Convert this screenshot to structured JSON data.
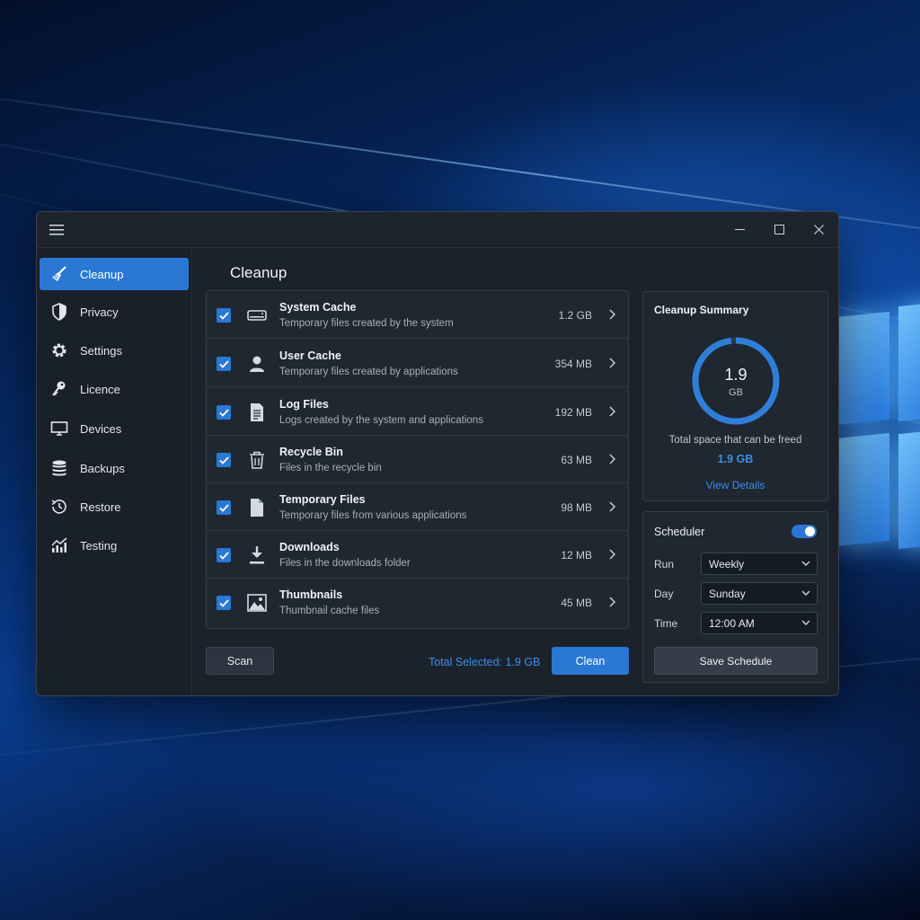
{
  "window": {
    "menu_icon": "hamburger-menu-icon",
    "controls": [
      "minimize-icon",
      "maximize-icon",
      "close-icon"
    ]
  },
  "sidebar": {
    "items": [
      {
        "label": "Cleanup",
        "icon": "broom-icon",
        "active": true
      },
      {
        "label": "Privacy",
        "icon": "shield-icon",
        "active": false
      },
      {
        "label": "Settings",
        "icon": "gear-icon",
        "active": false
      },
      {
        "label": "Licence",
        "icon": "key-icon",
        "active": false
      },
      {
        "label": "Devices",
        "icon": "monitor-icon",
        "active": false
      },
      {
        "label": "Backups",
        "icon": "database-icon",
        "active": false
      },
      {
        "label": "Restore",
        "icon": "restore-clock-icon",
        "active": false
      },
      {
        "label": "Testing",
        "icon": "chart-icon",
        "active": false
      }
    ]
  },
  "main": {
    "title": "Cleanup",
    "items": [
      {
        "title": "System Cache",
        "desc": "Temporary files created by the system",
        "size": "1.2 GB",
        "icon": "drive-icon",
        "checked": true
      },
      {
        "title": "User Cache",
        "desc": "Temporary files created by applications",
        "size": "354 MB",
        "icon": "user-icon",
        "checked": true
      },
      {
        "title": "Log Files",
        "desc": "Logs created by the system and applications",
        "size": "192 MB",
        "icon": "document-icon",
        "checked": true
      },
      {
        "title": "Recycle Bin",
        "desc": "Files in the recycle bin",
        "size": "63 MB",
        "icon": "trash-icon",
        "checked": true
      },
      {
        "title": "Temporary Files",
        "desc": "Temporary files from various applications",
        "size": "98 MB",
        "icon": "file-icon",
        "checked": true
      },
      {
        "title": "Downloads",
        "desc": "Files in the downloads folder",
        "size": "12 MB",
        "icon": "download-icon",
        "checked": true
      },
      {
        "title": "Thumbnails",
        "desc": "Thumbnail cache files",
        "size": "45 MB",
        "icon": "image-icon",
        "checked": true
      }
    ],
    "scan_label": "Scan",
    "total_selected": "Total Selected: 1.9 GB",
    "clean_label": "Clean"
  },
  "summary": {
    "title": "Cleanup Summary",
    "ring_value": "1.9",
    "ring_unit": "GB",
    "ring_fill": 0.98,
    "label": "Total space that can be freed",
    "value": "1.9 GB",
    "link": "View Details"
  },
  "scheduler": {
    "title": "Scheduler",
    "enabled": true,
    "run_label": "Run",
    "run_value": "Weekly",
    "day_label": "Day",
    "day_value": "Sunday",
    "time_label": "Time",
    "time_value": "12:00 AM",
    "save_label": "Save Schedule"
  },
  "colors": {
    "accent": "#2a78d4",
    "link": "#3d8ee6",
    "window_bg": "#1b222c",
    "panel_bg": "#1f2731"
  }
}
